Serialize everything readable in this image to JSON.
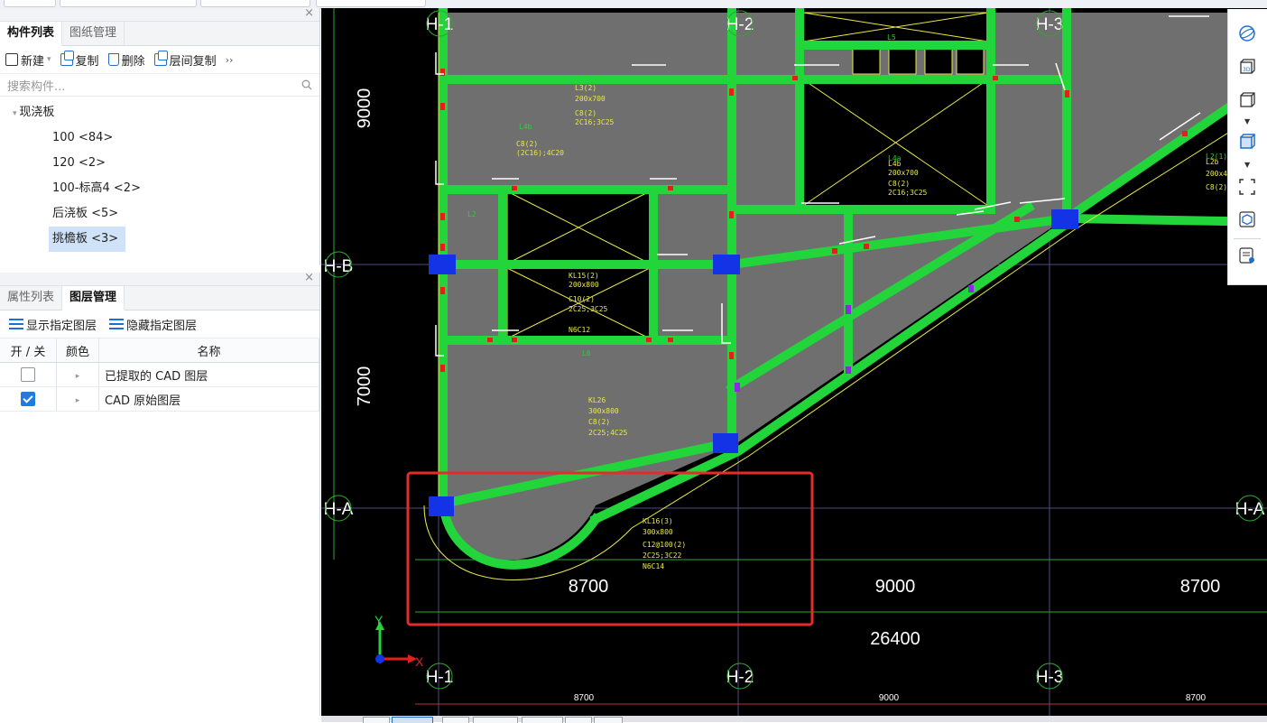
{
  "component_panel": {
    "tabs": [
      {
        "label": "构件列表",
        "active": true
      },
      {
        "label": "图纸管理",
        "active": false
      }
    ],
    "toolbar": {
      "new": "新建",
      "copy": "复制",
      "delete": "删除",
      "floor_copy": "层间复制",
      "more": "››"
    },
    "search_placeholder": "搜索构件...",
    "tree": {
      "root": "现浇板",
      "items": [
        {
          "label": "100 <84>",
          "selected": false
        },
        {
          "label": "120 <2>",
          "selected": false
        },
        {
          "label": "100-标高4 <2>",
          "selected": false
        },
        {
          "label": "后浇板 <5>",
          "selected": false
        },
        {
          "label": "挑檐板 <3>",
          "selected": true
        }
      ]
    }
  },
  "layer_panel": {
    "tabs": [
      {
        "label": "属性列表",
        "active": false
      },
      {
        "label": "图层管理",
        "active": true
      }
    ],
    "show_btn": "显示指定图层",
    "hide_btn": "隐藏指定图层",
    "columns": [
      "开 / 关",
      "颜色",
      "名称"
    ],
    "rows": [
      {
        "name": "已提取的 CAD 图层",
        "checked": false
      },
      {
        "name": "CAD 原始图层",
        "checked": true
      }
    ]
  },
  "viewport": {
    "axes": {
      "top": [
        "H-1",
        "H-2",
        "H-3"
      ],
      "left": [
        "H-B",
        "H-A"
      ],
      "right": [
        "H-A"
      ],
      "bottom": [
        "H-1",
        "H-2",
        "H-3"
      ]
    },
    "dims_left": [
      "9000",
      "7000"
    ],
    "dims_bottom": [
      "8700",
      "9000",
      "8700"
    ],
    "dim_total": "26400",
    "dims_small": [
      "8700",
      "9000",
      "8700"
    ],
    "beam_labels": [
      "L3(2)",
      "L4b",
      "L5",
      "L6",
      "L9(2)",
      "L4b",
      "L2",
      "KL15(2)",
      "L2",
      "L2b",
      "L6",
      "KL26",
      "L3a",
      "L1b",
      "L7",
      "L1",
      "L2b",
      "KL16(3)",
      "L2(1)"
    ],
    "beam_specs": [
      "200x700",
      "C8(2)",
      "2C16;3C25",
      "200x400",
      "300x800",
      "C10(2)",
      "2C25;3C25",
      "N6C12",
      "C12@100(2)",
      "2C25;3C22",
      "N6C14"
    ],
    "red_box_label": "",
    "colors": {
      "beam": "#21d53b",
      "slab": "#6f6f6f",
      "axis": "#ffffff",
      "grid": "#5a5a8c",
      "highlight": "#e52b2b",
      "column": "#1432e6"
    }
  },
  "right_toolbar": {
    "icons": [
      "orbit-icon",
      "3d-view-icon",
      "cube-icon",
      "solid-cube-icon",
      "frame-icon",
      "box-icon",
      "layer-list-icon"
    ]
  }
}
